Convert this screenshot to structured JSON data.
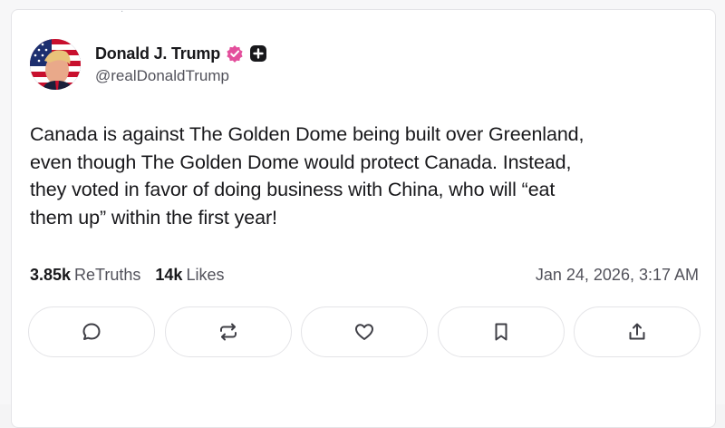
{
  "post": {
    "author": {
      "display_name": "Donald J. Trump",
      "handle": "@realDonaldTrump",
      "avatar": "avatar-flag-portrait",
      "verified_icon": "verified-badge-icon",
      "plus_icon": "plus-badge-icon"
    },
    "text": "Canada is against The Golden Dome being built over Greenland,\neven though The Golden Dome would protect Canada. Instead,\nthey voted in favor of doing business with China, who will “eat\nthem up” within the first year!",
    "stats": {
      "retruths_count": "3.85k",
      "retruths_label": "ReTruths",
      "likes_count": "14k",
      "likes_label": "Likes"
    },
    "timestamp": "Jan 24, 2026, 3:17 AM"
  },
  "actions": [
    {
      "name": "reply",
      "icon": "comment-icon"
    },
    {
      "name": "retruth",
      "icon": "repost-icon"
    },
    {
      "name": "like",
      "icon": "heart-icon"
    },
    {
      "name": "bookmark",
      "icon": "bookmark-icon"
    },
    {
      "name": "share",
      "icon": "share-icon"
    }
  ],
  "colors": {
    "text_primary": "#18181b",
    "text_secondary": "#52525b",
    "verified": "#e34f9c",
    "border": "#e4e4e7"
  }
}
